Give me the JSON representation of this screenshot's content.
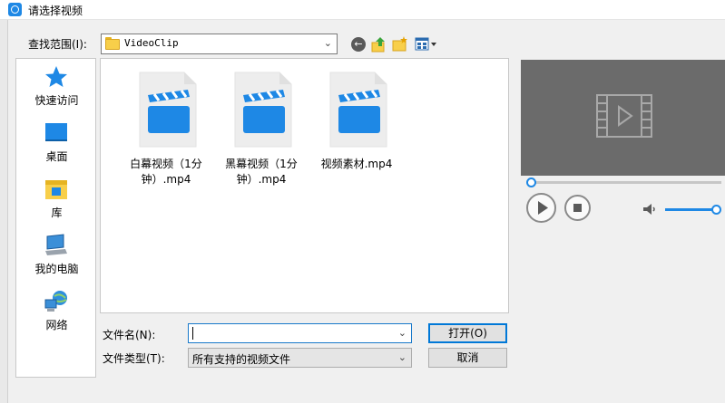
{
  "window": {
    "title": "请选择视频",
    "app_icon": "app-logo-icon"
  },
  "toolbar": {
    "look_in_label": "查找范围(I):",
    "look_in_value": "VideoClip",
    "icons": [
      "back-icon",
      "up-folder-icon",
      "new-folder-icon",
      "view-menu-icon"
    ]
  },
  "places": [
    {
      "label": "快速访问",
      "icon": "quick-access-star-icon"
    },
    {
      "label": "桌面",
      "icon": "desktop-icon"
    },
    {
      "label": "库",
      "icon": "library-icon"
    },
    {
      "label": "我的电脑",
      "icon": "computer-icon"
    },
    {
      "label": "网络",
      "icon": "network-icon"
    }
  ],
  "files": [
    {
      "name_line1": "白幕视频（1分",
      "name_line2": "钟）.mp4"
    },
    {
      "name_line1": "黑幕视频（1分",
      "name_line2": "钟）.mp4"
    },
    {
      "name_line1": "视频素材.mp4",
      "name_line2": ""
    }
  ],
  "form": {
    "file_name_label": "文件名(N):",
    "file_name_value": "",
    "file_type_label": "文件类型(T):",
    "file_type_value": "所有支持的视频文件",
    "open_label": "打开(O)",
    "cancel_label": "取消"
  },
  "preview": {
    "progress": 0.0,
    "volume": 1.0
  },
  "colors": {
    "accent": "#1e88e5",
    "file_icon_blue": "#1e88e5",
    "preview_bg": "#6b6b6b"
  }
}
